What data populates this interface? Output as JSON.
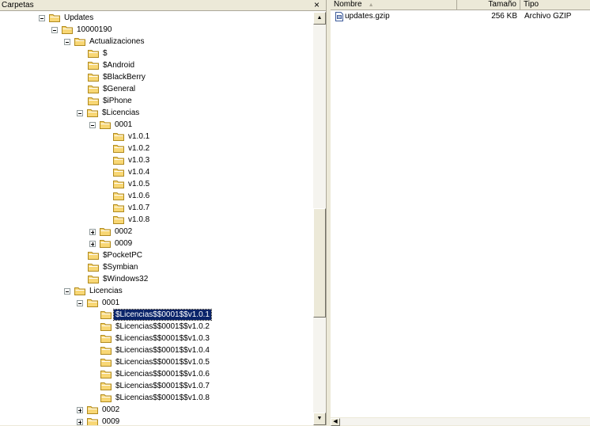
{
  "folders_pane": {
    "title": "Carpetas",
    "close": "×"
  },
  "tree": {
    "items": [
      {
        "label": "Updates",
        "level": 0,
        "expander": "minus"
      },
      {
        "label": "10000190",
        "level": 1,
        "expander": "minus"
      },
      {
        "label": "Actualizaciones",
        "level": 2,
        "expander": "minus"
      },
      {
        "label": "$",
        "level": 3,
        "expander": "none"
      },
      {
        "label": "$Android",
        "level": 3,
        "expander": "none"
      },
      {
        "label": "$BlackBerry",
        "level": 3,
        "expander": "none"
      },
      {
        "label": "$General",
        "level": 3,
        "expander": "none"
      },
      {
        "label": "$iPhone",
        "level": 3,
        "expander": "none"
      },
      {
        "label": "$Licencias",
        "level": 3,
        "expander": "minus"
      },
      {
        "label": "0001",
        "level": 4,
        "expander": "minus"
      },
      {
        "label": "v1.0.1",
        "level": 5,
        "expander": "none"
      },
      {
        "label": "v1.0.2",
        "level": 5,
        "expander": "none"
      },
      {
        "label": "v1.0.3",
        "level": 5,
        "expander": "none"
      },
      {
        "label": "v1.0.4",
        "level": 5,
        "expander": "none"
      },
      {
        "label": "v1.0.5",
        "level": 5,
        "expander": "none"
      },
      {
        "label": "v1.0.6",
        "level": 5,
        "expander": "none"
      },
      {
        "label": "v1.0.7",
        "level": 5,
        "expander": "none"
      },
      {
        "label": "v1.0.8",
        "level": 5,
        "expander": "none"
      },
      {
        "label": "0002",
        "level": 4,
        "expander": "plus"
      },
      {
        "label": "0009",
        "level": 4,
        "expander": "plus"
      },
      {
        "label": "$PocketPC",
        "level": 3,
        "expander": "none"
      },
      {
        "label": "$Symbian",
        "level": 3,
        "expander": "none"
      },
      {
        "label": "$Windows32",
        "level": 3,
        "expander": "none"
      },
      {
        "label": "Licencias",
        "level": 2,
        "expander": "minus"
      },
      {
        "label": "0001",
        "level": 3,
        "expander": "minus"
      },
      {
        "label": "$Licencias$$0001$$v1.0.1",
        "level": 4,
        "expander": "none",
        "selected": true
      },
      {
        "label": "$Licencias$$0001$$v1.0.2",
        "level": 4,
        "expander": "none"
      },
      {
        "label": "$Licencias$$0001$$v1.0.3",
        "level": 4,
        "expander": "none"
      },
      {
        "label": "$Licencias$$0001$$v1.0.4",
        "level": 4,
        "expander": "none"
      },
      {
        "label": "$Licencias$$0001$$v1.0.5",
        "level": 4,
        "expander": "none"
      },
      {
        "label": "$Licencias$$0001$$v1.0.6",
        "level": 4,
        "expander": "none"
      },
      {
        "label": "$Licencias$$0001$$v1.0.7",
        "level": 4,
        "expander": "none"
      },
      {
        "label": "$Licencias$$0001$$v1.0.8",
        "level": 4,
        "expander": "none"
      },
      {
        "label": "0002",
        "level": 3,
        "expander": "plus"
      },
      {
        "label": "0009",
        "level": 3,
        "expander": "plus"
      }
    ]
  },
  "files_pane": {
    "columns": {
      "name": "Nombre",
      "size": "Tamaño",
      "type": "Tipo"
    },
    "files": [
      {
        "name": "updates.gzip",
        "size": "256 KB",
        "type": "Archivo GZIP",
        "icon": "gzip-file-icon"
      }
    ]
  },
  "colors": {
    "selection": "#0a246a",
    "folder": "#f8d775",
    "chrome": "#ece9d8"
  }
}
